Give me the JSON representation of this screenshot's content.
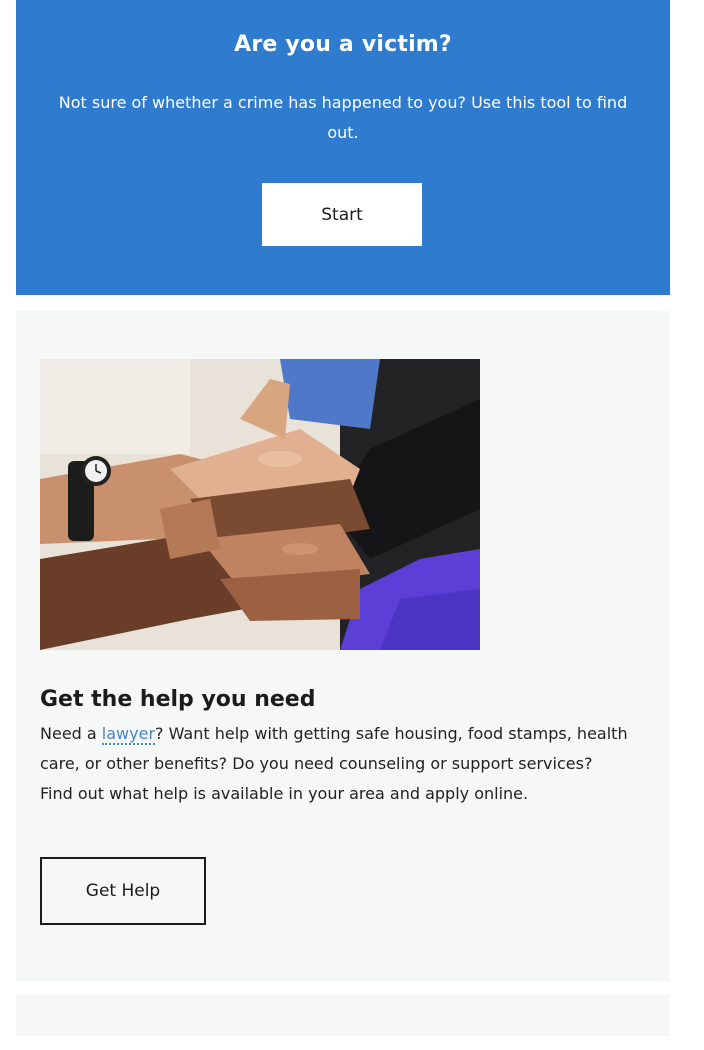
{
  "victim_card": {
    "title": "Are you a victim?",
    "text": "Not sure of whether a crime has happened to you? Use this tool to find out.",
    "button_label": "Start",
    "background_color": "#2f7bcd"
  },
  "help_card": {
    "image_alt": "Stacked hands of several people",
    "title": "Get the help you need",
    "text_before_link": "Need a ",
    "link_text": "lawyer",
    "text_after_link": "? Want help with getting safe housing, food stamps, health care, or other benefits? Do you need counseling or support services? Find out what help is available in your area and apply online.",
    "button_label": "Get Help"
  }
}
